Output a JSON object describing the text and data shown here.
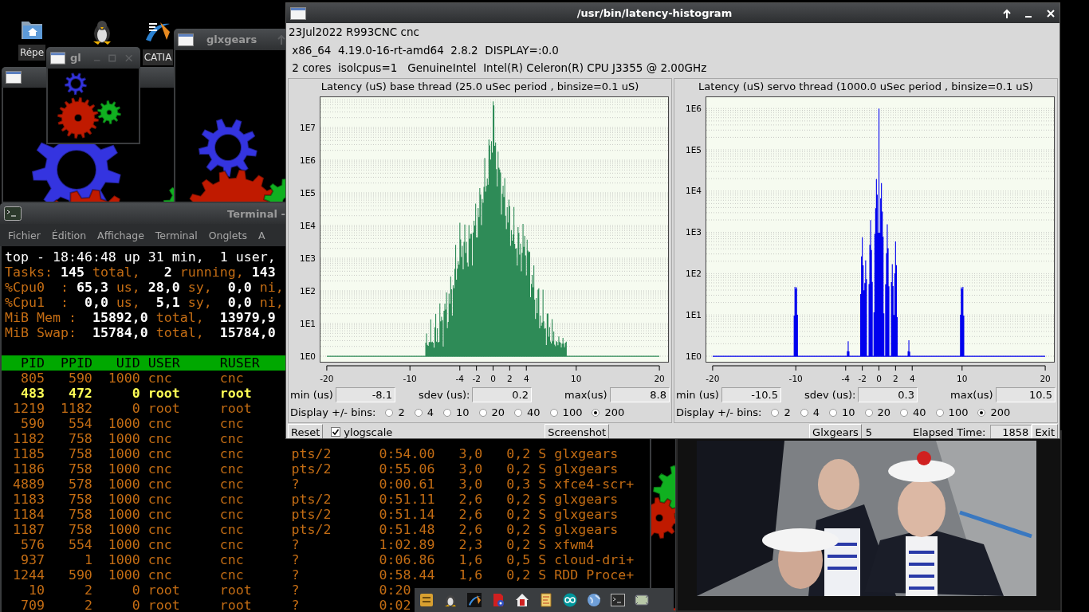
{
  "desktop": {
    "icons": [
      {
        "kind": "folder",
        "label": "Répe"
      },
      {
        "kind": "penguin"
      },
      {
        "kind": "swoosh",
        "label": "CATIA"
      }
    ]
  },
  "gear_windows": [
    {
      "kind": "untitled"
    },
    {
      "kind": "glxgears",
      "title": "glxgears"
    },
    {
      "kind": "small",
      "title": "gl"
    }
  ],
  "terminal": {
    "title": "Terminal -",
    "menu": [
      "Fichier",
      "Édition",
      "Affichage",
      "Terminal",
      "Onglets",
      "A"
    ],
    "summary": [
      [
        {
          "text": "top - 18:46:48 up 31 min,  1 user,",
          "kind": "plain"
        }
      ],
      [
        {
          "text": "Tasks:",
          "kind": "label"
        },
        {
          "text": " 145",
          "kind": "value"
        },
        {
          "text": " total,   ",
          "kind": "label"
        },
        {
          "text": "2",
          "kind": "value"
        },
        {
          "text": " running, ",
          "kind": "label"
        },
        {
          "text": "143",
          "kind": "value"
        }
      ],
      [
        {
          "text": "%Cpu0  :",
          "kind": "label"
        },
        {
          "text": " 65,3",
          "kind": "value"
        },
        {
          "text": " us, ",
          "kind": "label"
        },
        {
          "text": "28,0",
          "kind": "value"
        },
        {
          "text": " sy, ",
          "kind": "label"
        },
        {
          "text": " 0,0",
          "kind": "value"
        },
        {
          "text": " ni,",
          "kind": "label"
        }
      ],
      [
        {
          "text": "%Cpu1  :",
          "kind": "label"
        },
        {
          "text": "  0,0",
          "kind": "value"
        },
        {
          "text": " us,  ",
          "kind": "label"
        },
        {
          "text": "5,1",
          "kind": "value"
        },
        {
          "text": " sy, ",
          "kind": "label"
        },
        {
          "text": " 0,0",
          "kind": "value"
        },
        {
          "text": " ni,",
          "kind": "label"
        }
      ],
      [
        {
          "text": "MiB Mem :",
          "kind": "label"
        },
        {
          "text": "  15892,0",
          "kind": "value"
        },
        {
          "text": " total,  ",
          "kind": "label"
        },
        {
          "text": "13979,9",
          "kind": "value"
        }
      ],
      [
        {
          "text": "MiB Swap:",
          "kind": "label"
        },
        {
          "text": "  15784,0",
          "kind": "value"
        },
        {
          "text": " total,  ",
          "kind": "label"
        },
        {
          "text": "15784,0",
          "kind": "value"
        }
      ]
    ],
    "columns": [
      "PID",
      "PPID",
      "UID",
      "USER",
      "RUSER"
    ],
    "rows": [
      {
        "highlighted": false,
        "cells": [
          "805",
          "590",
          "1000",
          "cnc",
          "cnc"
        ]
      },
      {
        "highlighted": true,
        "cells": [
          "483",
          "472",
          "0",
          "root",
          "root"
        ]
      },
      {
        "highlighted": false,
        "cells": [
          "1219",
          "1182",
          "0",
          "root",
          "root"
        ]
      },
      {
        "highlighted": false,
        "cells": [
          "590",
          "554",
          "1000",
          "cnc",
          "cnc"
        ]
      },
      {
        "highlighted": false,
        "cells": [
          "1182",
          "758",
          "1000",
          "cnc",
          "cnc"
        ]
      },
      {
        "highlighted": false,
        "cells": [
          "1185",
          "758",
          "1000",
          "cnc",
          "cnc",
          "pts/2",
          "0:54.00",
          "3,0",
          "0,2",
          "S",
          "glxgears"
        ]
      },
      {
        "highlighted": false,
        "cells": [
          "1186",
          "758",
          "1000",
          "cnc",
          "cnc",
          "pts/2",
          "0:55.06",
          "3,0",
          "0,2",
          "S",
          "glxgears"
        ]
      },
      {
        "highlighted": false,
        "cells": [
          "4889",
          "578",
          "1000",
          "cnc",
          "cnc",
          "?",
          "0:00.61",
          "3,0",
          "0,3",
          "S",
          "xfce4-scr+"
        ]
      },
      {
        "highlighted": false,
        "cells": [
          "1183",
          "758",
          "1000",
          "cnc",
          "cnc",
          "pts/2",
          "0:51.11",
          "2,6",
          "0,2",
          "S",
          "glxgears"
        ]
      },
      {
        "highlighted": false,
        "cells": [
          "1184",
          "758",
          "1000",
          "cnc",
          "cnc",
          "pts/2",
          "0:51.14",
          "2,6",
          "0,2",
          "S",
          "glxgears"
        ]
      },
      {
        "highlighted": false,
        "cells": [
          "1187",
          "758",
          "1000",
          "cnc",
          "cnc",
          "pts/2",
          "0:51.48",
          "2,6",
          "0,2",
          "S",
          "glxgears"
        ]
      },
      {
        "highlighted": false,
        "cells": [
          "576",
          "554",
          "1000",
          "cnc",
          "cnc",
          "?",
          "1:02.89",
          "2,3",
          "0,2",
          "S",
          "xfwm4"
        ]
      },
      {
        "highlighted": false,
        "cells": [
          "937",
          "1",
          "1000",
          "cnc",
          "cnc",
          "?",
          "0:06.86",
          "1,6",
          "0,5",
          "S",
          "cloud-dri+"
        ]
      },
      {
        "highlighted": false,
        "cells": [
          "1244",
          "590",
          "1000",
          "cnc",
          "cnc",
          "?",
          "0:58.44",
          "1,6",
          "0,2",
          "S",
          "RDD Proce+"
        ]
      },
      {
        "highlighted": false,
        "cells": [
          "10",
          "2",
          "0",
          "root",
          "root",
          "?",
          "0:20"
        ]
      },
      {
        "highlighted": false,
        "cells": [
          "709",
          "2",
          "0",
          "root",
          "root",
          "?",
          "0:02"
        ]
      }
    ]
  },
  "histogram_window": {
    "title": "/usr/bin/latency-histogram",
    "info": [
      "23Jul2022 R993CNC cnc",
      " x86_64  4.19.0-16-rt-amd64  2.8.2  DISPLAY=:0.0",
      " 2 cores  isolcpus=1   GenuineIntel  Intel(R) Celeron(R) CPU J3355 @ 2.00GHz"
    ],
    "panels": [
      {
        "kind": "base",
        "title": "Latency (uS) base thread (25.0 uSec period , binsize=0.1 uS)",
        "yticks": [
          "1E7",
          "1E6",
          "1E5",
          "1E4",
          "1E3",
          "1E2",
          "1E1",
          "1E0"
        ],
        "xticks": [
          "-20",
          "-10",
          "-4",
          "-2",
          "0",
          "2",
          "4",
          "10",
          "20"
        ],
        "min_label": "min (us)",
        "min": "-8.1",
        "sdev_label": "sdev (us):",
        "sdev": "0.2",
        "max_label": "max(us)",
        "max": "8.8",
        "bins_label": "Display +/- bins:",
        "bins": [
          {
            "label": "2",
            "selected": false
          },
          {
            "label": "4",
            "selected": false
          },
          {
            "label": "10",
            "selected": false
          },
          {
            "label": "20",
            "selected": false
          },
          {
            "label": "40",
            "selected": false
          },
          {
            "label": "100",
            "selected": false
          },
          {
            "label": "200",
            "selected": true
          }
        ]
      },
      {
        "kind": "servo",
        "title": "Latency (uS) servo thread (1000.0 uSec period , binsize=0.1 uS)",
        "yticks": [
          "1E6",
          "1E5",
          "1E4",
          "1E3",
          "1E2",
          "1E1",
          "1E0"
        ],
        "xticks": [
          "-20",
          "-10",
          "-4",
          "-2",
          "0",
          "2",
          "4",
          "10",
          "20"
        ],
        "min_label": "min (us)",
        "min": "-10.5",
        "sdev_label": "sdev (us):",
        "sdev": "0.3",
        "max_label": "max(us)",
        "max": "10.5",
        "bins_label": "Display +/- bins:",
        "bins": [
          {
            "label": "2",
            "selected": false
          },
          {
            "label": "4",
            "selected": false
          },
          {
            "label": "10",
            "selected": false
          },
          {
            "label": "20",
            "selected": false
          },
          {
            "label": "40",
            "selected": false
          },
          {
            "label": "100",
            "selected": false
          },
          {
            "label": "200",
            "selected": true
          }
        ]
      }
    ],
    "footer": {
      "reset": "Reset",
      "ylogscale": {
        "label": "ylogscale",
        "checked": true
      },
      "screenshot": "Screenshot",
      "glxgears": "Glxgears",
      "glxgears_count": "5",
      "elapsed_label": "Elapsed Time:",
      "elapsed": "1858",
      "exit": "Exit"
    }
  },
  "taskbar": {
    "launchers": [
      {
        "kind": "drawer"
      },
      {
        "kind": "penguin"
      },
      {
        "kind": "swoosh"
      },
      {
        "kind": "gear-doc"
      },
      {
        "kind": "house"
      },
      {
        "kind": "doc"
      },
      {
        "kind": "infinity"
      },
      {
        "kind": "globe"
      },
      {
        "kind": "terminal"
      },
      {
        "kind": "screen"
      }
    ]
  }
}
